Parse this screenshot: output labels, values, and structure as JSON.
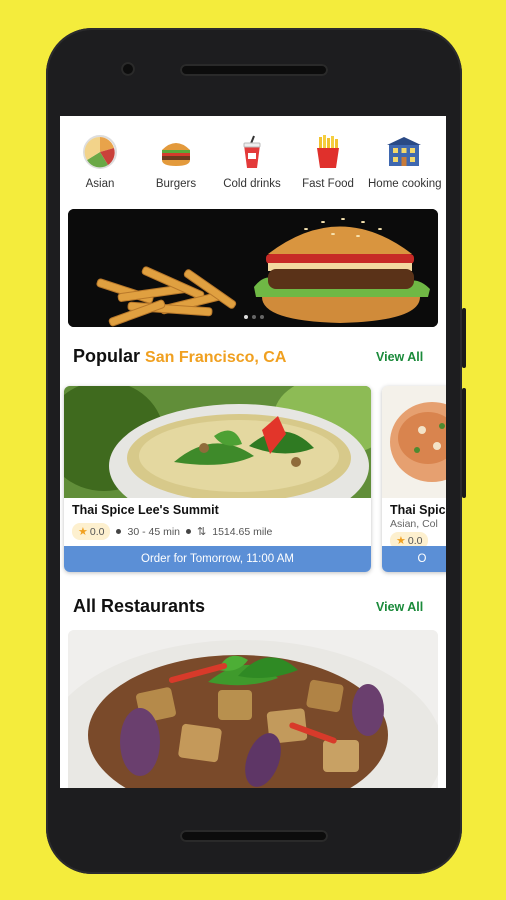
{
  "categories": [
    {
      "label": "Asian",
      "icon": "asian-food-icon"
    },
    {
      "label": "Burgers",
      "icon": "burger-icon"
    },
    {
      "label": "Cold drinks",
      "icon": "cold-drink-icon"
    },
    {
      "label": "Fast Food",
      "icon": "fries-icon"
    },
    {
      "label": "Home cooking",
      "icon": "house-icon"
    }
  ],
  "popular": {
    "title": "Popular",
    "city": "San Francisco, CA",
    "view_all": "View All",
    "cards": [
      {
        "name": "Thai Spice Lee's Summit",
        "rating": "0.0",
        "time": "30 - 45 min",
        "distance": "1514.65 mile",
        "order_label": "Order for Tomorrow, 11:00 AM"
      },
      {
        "name": "Thai Spic",
        "subtitle": "Asian, Col",
        "rating": "0.0",
        "order_label": "O"
      }
    ]
  },
  "all_restaurants": {
    "title": "All Restaurants",
    "view_all": "View All"
  },
  "colors": {
    "background": "#f4ec3c",
    "accent": "#f0a020",
    "link": "#1a8a3a",
    "order_bar": "#5b8fd6"
  }
}
